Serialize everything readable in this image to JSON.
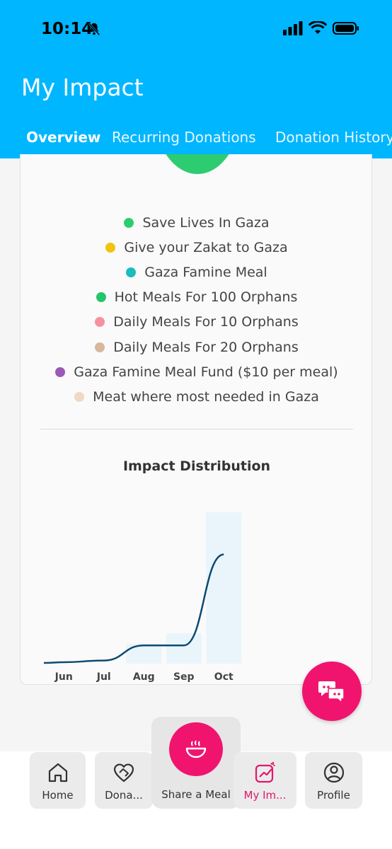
{
  "status_bar": {
    "time": "10:14"
  },
  "header": {
    "title": "My Impact",
    "tabs": [
      {
        "label": "Overview",
        "active": true
      },
      {
        "label": "Recurring Donations",
        "active": false
      },
      {
        "label": "Donation History",
        "active": false
      }
    ]
  },
  "legend": [
    {
      "label": "Save Lives In Gaza",
      "color": "#2ecc71"
    },
    {
      "label": "Give your Zakat to Gaza",
      "color": "#f1c40f"
    },
    {
      "label": "Gaza Famine Meal",
      "color": "#1abcbc"
    },
    {
      "label": "Hot Meals For 100 Orphans",
      "color": "#27c46a"
    },
    {
      "label": "Daily Meals For 10 Orphans",
      "color": "#f7919f"
    },
    {
      "label": "Daily Meals For 20 Orphans",
      "color": "#d6b89a"
    },
    {
      "label": "Gaza Famine Meal Fund ($10 per meal)",
      "color": "#9b59b6"
    },
    {
      "label": "Meat where most needed in Gaza",
      "color": "#f0d8c4"
    }
  ],
  "chart_data": {
    "type": "bar",
    "title": "Impact Distribution",
    "categories": [
      "Jun",
      "Jul",
      "Aug",
      "Sep",
      "Oct"
    ],
    "values": [
      0,
      0,
      12,
      18,
      90
    ],
    "trend_line": [
      0,
      1,
      10,
      10,
      64
    ],
    "ylim": [
      0,
      100
    ],
    "bar_color": "#eaf5fb",
    "line_color": "#0d4a72"
  },
  "bottom_nav": {
    "items": [
      {
        "label": "Home"
      },
      {
        "label": "Dona..."
      },
      {
        "label": "Share a Meal"
      },
      {
        "label": "My Im...",
        "active": true
      },
      {
        "label": "Profile"
      }
    ],
    "accent": "#f0146f"
  }
}
